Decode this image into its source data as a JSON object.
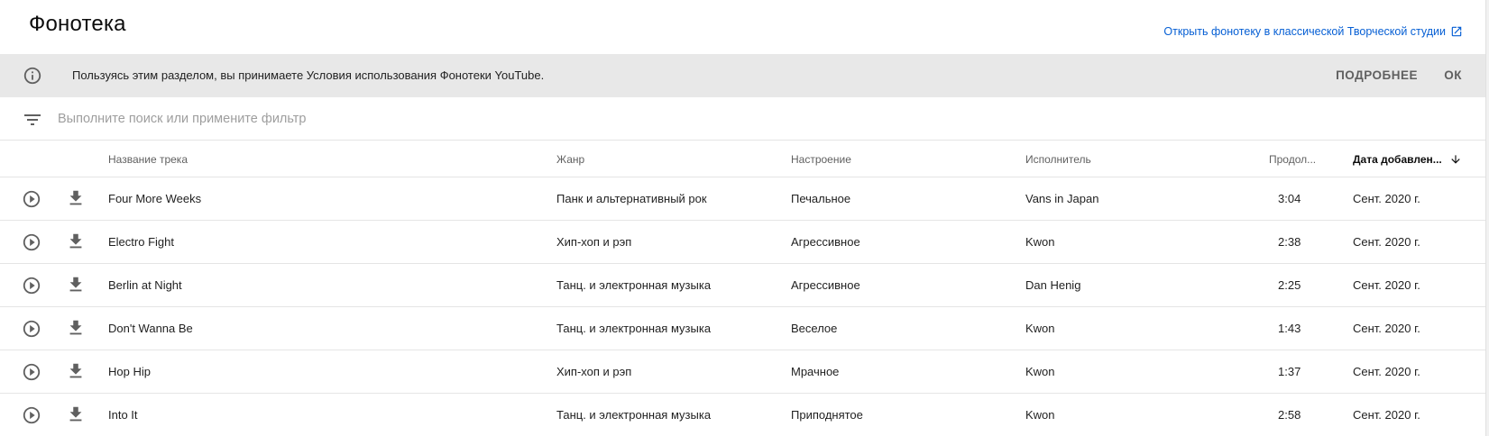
{
  "header": {
    "title": "Фонотека",
    "classic_link": "Открыть фонотеку в классической Творческой студии"
  },
  "banner": {
    "text": "Пользуясь этим разделом, вы принимаете Условия использования Фонотеки YouTube.",
    "more_label": "ПОДРОБНЕЕ",
    "ok_label": "ОК"
  },
  "filter": {
    "placeholder": "Выполните поиск или примените фильтр",
    "value": ""
  },
  "table": {
    "columns": {
      "title": "Название трека",
      "genre": "Жанр",
      "mood": "Настроение",
      "artist": "Исполнитель",
      "duration": "Продол...",
      "date": "Дата добавлен..."
    },
    "sorted_by": "date",
    "sort_direction": "descending",
    "rows": [
      {
        "title": "Four More Weeks",
        "genre": "Панк и альтернативный рок",
        "mood": "Печальное",
        "artist": "Vans in Japan",
        "duration": "3:04",
        "date": "Сент. 2020 г."
      },
      {
        "title": "Electro Fight",
        "genre": "Хип-хоп и рэп",
        "mood": "Агрессивное",
        "artist": "Kwon",
        "duration": "2:38",
        "date": "Сент. 2020 г."
      },
      {
        "title": "Berlin at Night",
        "genre": "Танц. и электронная музыка",
        "mood": "Агрессивное",
        "artist": "Dan Henig",
        "duration": "2:25",
        "date": "Сент. 2020 г."
      },
      {
        "title": "Don't Wanna Be",
        "genre": "Танц. и электронная музыка",
        "mood": "Веселое",
        "artist": "Kwon",
        "duration": "1:43",
        "date": "Сент. 2020 г."
      },
      {
        "title": "Hop Hip",
        "genre": "Хип-хоп и рэп",
        "mood": "Мрачное",
        "artist": "Kwon",
        "duration": "1:37",
        "date": "Сент. 2020 г."
      },
      {
        "title": "Into It",
        "genre": "Танц. и электронная музыка",
        "mood": "Приподнятое",
        "artist": "Kwon",
        "duration": "2:58",
        "date": "Сент. 2020 г."
      }
    ]
  },
  "icons": {
    "info": "info-icon",
    "external": "open-in-new-icon",
    "filter": "filter-list-icon",
    "play": "play-circle-icon",
    "download": "download-icon",
    "sort": "arrow-down-icon"
  },
  "colors": {
    "link": "#065fd4",
    "banner_bg": "#e8e8e8",
    "icon": "#606060"
  }
}
